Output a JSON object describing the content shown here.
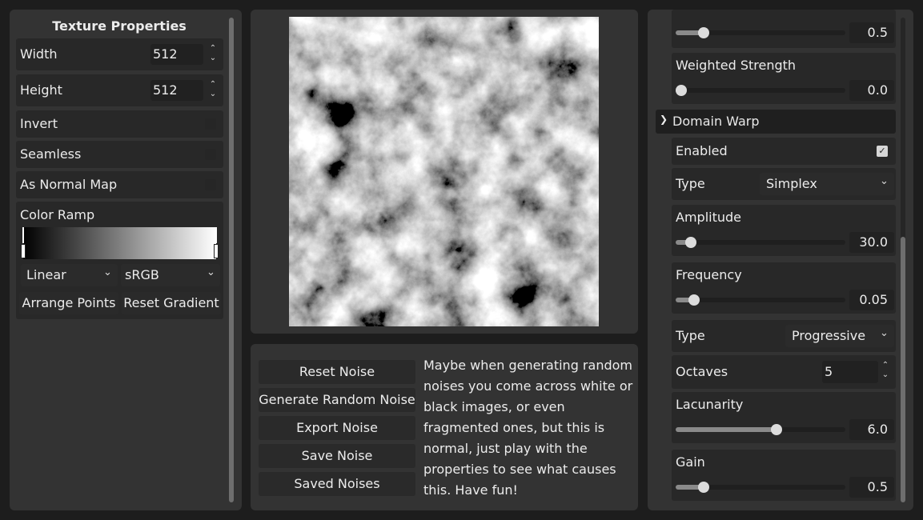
{
  "left": {
    "title": "Texture Properties",
    "width_label": "Width",
    "width_value": "512",
    "height_label": "Height",
    "height_value": "512",
    "invert_label": "Invert",
    "seamless_label": "Seamless",
    "normal_map_label": "As Normal Map",
    "color_ramp_label": "Color Ramp",
    "interp_select": "Linear",
    "color_space_select": "sRGB",
    "arrange_points": "Arrange Points",
    "reset_gradient": "Reset Gradient"
  },
  "actions": {
    "reset_noise": "Reset Noise",
    "generate_random": "Generate Random Noise",
    "export_noise": "Export Noise",
    "save_noise": "Save Noise",
    "saved_noises": "Saved Noises",
    "info_text": "Maybe when generating random noises you come across white or black images, or even fragmented ones, but this is normal, just play with the properties to see what causes this. Have fun!"
  },
  "right": {
    "top_slider_value": "0.5",
    "top_slider_level": 0.14,
    "weighted_strength_label": "Weighted Strength",
    "weighted_strength_value": "0.0",
    "weighted_strength_level": 0.0,
    "domain_warp_label": "Domain Warp",
    "enabled_label": "Enabled",
    "enabled_checked": true,
    "type_label": "Type",
    "type_value": "Simplex",
    "amplitude_label": "Amplitude",
    "amplitude_value": "30.0",
    "amplitude_level": 0.06,
    "frequency_label": "Frequency",
    "frequency_value": "0.05",
    "frequency_level": 0.08,
    "fractal_type_label": "Type",
    "fractal_type_value": "Progressive",
    "octaves_label": "Octaves",
    "octaves_value": "5",
    "lacunarity_label": "Lacunarity",
    "lacunarity_value": "6.0",
    "lacunarity_level": 0.6,
    "gain_label": "Gain",
    "gain_value": "0.5",
    "gain_level": 0.14
  },
  "icons": {
    "spin": "spin-up-down-icon",
    "chevron": "chevron-down-icon",
    "section": "chevron-down-icon",
    "check": "check-icon"
  },
  "colors": {
    "background": "#1d1d1d",
    "panel": "#333333",
    "row": "#282828"
  }
}
